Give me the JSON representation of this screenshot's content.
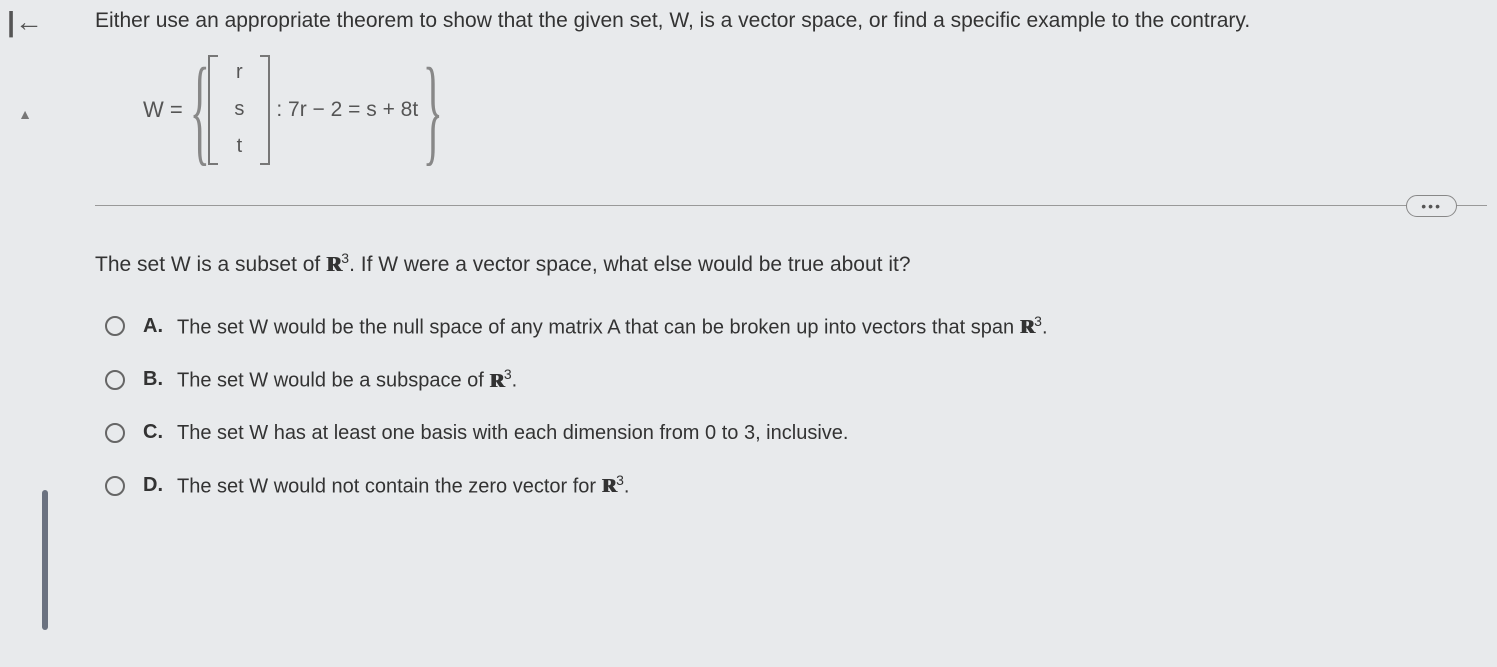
{
  "nav": {
    "back_icon": "|←",
    "collapse_icon": "▲"
  },
  "question": {
    "prompt": "Either use an appropriate theorem to show that the given set, W, is a vector space, or find a specific example to the contrary.",
    "set_label": "W =",
    "vector": [
      "r",
      "s",
      "t"
    ],
    "condition": ": 7r − 2 = s + 8t",
    "more_label": "•••",
    "sub_prompt_pre": "The set W is a subset of ",
    "sub_prompt_R": "R",
    "sub_prompt_exp": "3",
    "sub_prompt_post": ". If W were a vector space, what else would be true about it?"
  },
  "options": [
    {
      "letter": "A.",
      "text_pre": "The set W would be the null space of any matrix A that can be broken up into vectors that span ",
      "R": "R",
      "exp": "3",
      "text_post": "."
    },
    {
      "letter": "B.",
      "text_pre": "The set W would be a subspace of ",
      "R": "R",
      "exp": "3",
      "text_post": "."
    },
    {
      "letter": "C.",
      "text_pre": "The set W has at least one basis with each dimension from 0 to 3, inclusive.",
      "R": "",
      "exp": "",
      "text_post": ""
    },
    {
      "letter": "D.",
      "text_pre": "The set W would not contain the zero vector for ",
      "R": "R",
      "exp": "3",
      "text_post": "."
    }
  ]
}
